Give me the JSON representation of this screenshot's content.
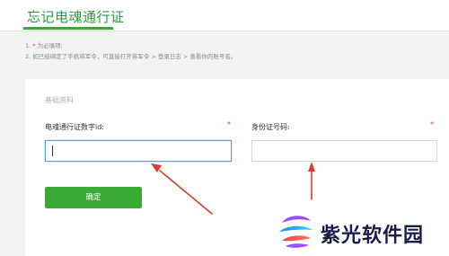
{
  "header": {
    "title": "忘记电魂通行证"
  },
  "notes": {
    "line1_prefix": "1. ",
    "line1_mark": "*",
    "line1_text": " 为必填项;",
    "line2": "2. 如已经绑定了手机将军令，可直接打开将军令 > 登录日志 > 查看你的账号名。"
  },
  "form": {
    "section_label": "基础资料",
    "id_field": {
      "label": "电魂通行证数字id:",
      "required_mark": "*",
      "value": ""
    },
    "idcard_field": {
      "label": "身份证号码:",
      "required_mark": "*",
      "value": ""
    },
    "confirm_label": "确定"
  },
  "watermark": {
    "text": "紫光软件园"
  },
  "colors": {
    "brand_green": "#3aaa35",
    "title_green": "#2e9a3f",
    "required_red": "#e4393c",
    "focus_blue": "#5b9bd5",
    "annotation_red": "#e03a2f"
  }
}
